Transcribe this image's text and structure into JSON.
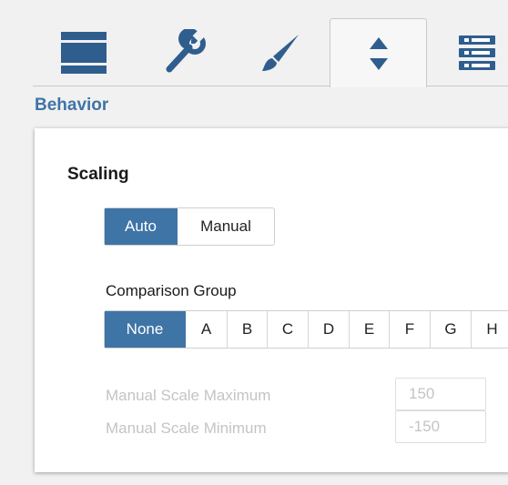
{
  "tabs": [
    {
      "icon": "layout-bars-icon"
    },
    {
      "icon": "wrench-icon"
    },
    {
      "icon": "paintbrush-icon"
    },
    {
      "icon": "sort-arrows-icon",
      "active": true
    },
    {
      "icon": "list-rows-icon"
    }
  ],
  "section": {
    "title": "Behavior"
  },
  "scaling": {
    "heading": "Scaling",
    "options": [
      "Auto",
      "Manual"
    ],
    "selected": "Auto"
  },
  "comparison_group": {
    "label": "Comparison Group",
    "options": [
      "None",
      "A",
      "B",
      "C",
      "D",
      "E",
      "F",
      "G",
      "H"
    ],
    "selected": "None"
  },
  "manual_scale": {
    "max_label": "Manual Scale Maximum",
    "max_value": "150",
    "min_label": "Manual Scale Minimum",
    "min_value": "-150"
  },
  "colors": {
    "accent": "#3f74a6",
    "icon": "#2f5e8e",
    "disabled_text": "#c4c4c4"
  }
}
